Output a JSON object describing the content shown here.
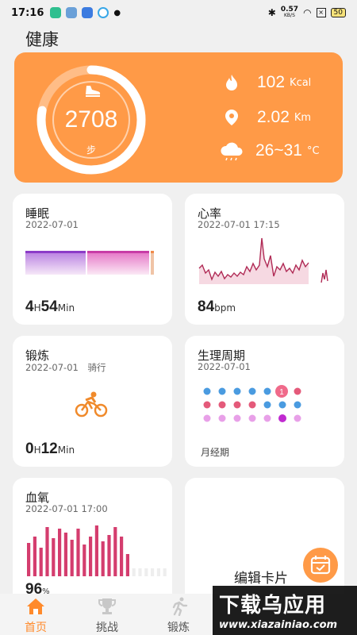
{
  "status_bar": {
    "time": "17:16",
    "net_speed": "0.57",
    "net_unit": "KB/S",
    "battery": "50"
  },
  "page_title": "健康",
  "summary": {
    "steps": "2708",
    "steps_unit": "步",
    "step_goal_fraction": 0.78,
    "calories": "102",
    "calories_unit": "Kcal",
    "distance": "2.02",
    "distance_unit": "Km",
    "temperature": "26~31",
    "temperature_unit": "°C",
    "accent_color": "#ff9a47"
  },
  "cards": {
    "sleep": {
      "title": "睡眠",
      "date": "2022-07-01",
      "hours": "4",
      "hours_unit": "H",
      "minutes": "54",
      "minutes_unit": "Min"
    },
    "heart": {
      "title": "心率",
      "date": "2022-07-01 17:15",
      "value": "84",
      "unit": "bpm",
      "color": "#c0305a"
    },
    "exercise": {
      "title": "锻炼",
      "date": "2022-07-01",
      "activity": "骑行",
      "hours": "0",
      "hours_unit": "H",
      "minutes": "12",
      "minutes_unit": "Min",
      "icon": "bicycle-icon"
    },
    "cycle": {
      "title": "生理周期",
      "date": "2022-07-01",
      "marker": "1",
      "label": "月经期"
    },
    "oxygen": {
      "title": "血氧",
      "date": "2022-07-01 17:00",
      "value": "96",
      "unit": "%"
    },
    "edit": {
      "label": "编辑卡片",
      "icon": "calendar-edit-icon"
    }
  },
  "nav": {
    "items": [
      {
        "label": "首页",
        "icon": "home-icon",
        "active": true
      },
      {
        "label": "挑战",
        "icon": "trophy-icon",
        "active": false
      },
      {
        "label": "锻炼",
        "icon": "running-icon",
        "active": false
      }
    ]
  },
  "watermark": {
    "title": "下载乌应用",
    "url": "www.xiazainiao.com"
  }
}
